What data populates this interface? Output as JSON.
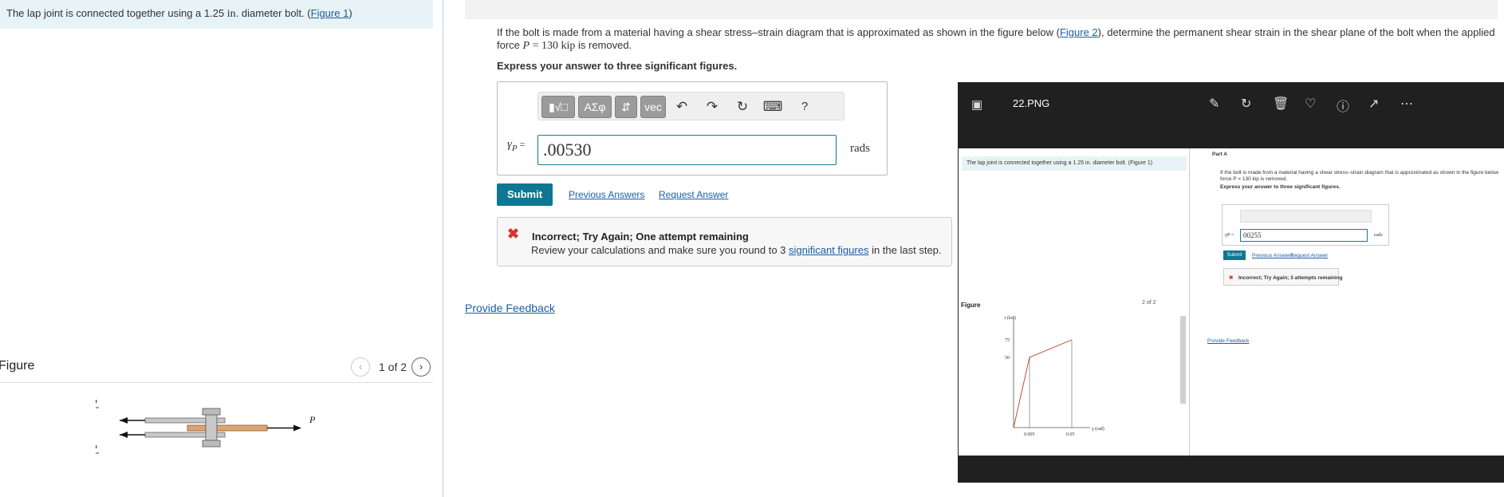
{
  "left": {
    "intro_prefix": "The lap joint is connected together using a 1.25 ",
    "intro_unit": "in",
    "intro_suffix": ". diameter bolt. (",
    "intro_link": "Figure 1",
    "intro_close": ")",
    "figure_title": "Figure",
    "figure_counter": "1 of 2",
    "prev_icon": "chevron-left-icon",
    "next_icon": "chevron-right-icon",
    "figure_labels": {
      "p_half_num": "P",
      "p_half_den": "2",
      "p": "P"
    }
  },
  "question": {
    "text1": "If the bolt is made from a material having a shear stress–strain diagram that is approximated as shown in the figure below (",
    "link": "Figure 2",
    "text2": "), determine the permanent shear strain in the shear plane of the bolt when the applied force ",
    "var": "P",
    "eq": " = 130 ",
    "unit": "kip",
    "text3": " is removed.",
    "instruction": "Express your answer to three significant figures."
  },
  "toolbar": {
    "btn_templates": "▮√□",
    "btn_symbols": "ΑΣφ",
    "btn_arrows": "⇵",
    "btn_vec": "vec",
    "undo_icon": "↶",
    "redo_icon": "↷",
    "reset_icon": "↻",
    "keyboard_icon": "⌨",
    "help": "?"
  },
  "answer": {
    "label_symbol": "γ",
    "label_sub": "P",
    "label_eq": " =",
    "value": ".00530",
    "units": "rads"
  },
  "actions": {
    "submit": "Submit",
    "previous_answers": "Previous Answers",
    "request_answer": "Request Answer"
  },
  "feedback": {
    "icon": "✖",
    "title": "Incorrect; Try Again; One attempt remaining",
    "detail_prefix": "Review your calculations and make sure you round to 3 ",
    "detail_link": "significant figures",
    "detail_suffix": " in the last step."
  },
  "provide_feedback": "Provide Feedback",
  "viewer": {
    "filename": "22.PNG",
    "icons": [
      "edit-icon",
      "rotate-icon",
      "delete-icon",
      "favorite-icon",
      "info-icon",
      "share-icon",
      "more-icon"
    ],
    "thumb": {
      "intro": "The lap joint is connected together using a 1.25 in. diameter bolt. (Figure 1)",
      "figure_title": "Figure",
      "figure_nav": "2 of 2",
      "part": "Part A",
      "question": "If the bolt is made from a material having a shear stress–strain diagram that is approximated as shown in the figure below",
      "force": "force P = 130 kip is removed.",
      "instruction": "Express your answer to three significant figures.",
      "answer": "00255",
      "units": "rads",
      "label": "γP =",
      "submit": "Submit",
      "prev": "Previous Answers",
      "request": "Request Answer",
      "feedback": "Incorrect; Try Again; 3 attempts remaining",
      "provide_feedback": "Provide Feedback"
    }
  },
  "chart_data": {
    "type": "line",
    "title": "",
    "ylabel": "τ (ksi)",
    "xlabel": "γ (rad)",
    "yticks": [
      "75",
      "50"
    ],
    "xticks": [
      "0.005",
      "0.05"
    ],
    "x": [
      0,
      0.005,
      0.05
    ],
    "y": [
      0,
      50,
      75
    ]
  }
}
